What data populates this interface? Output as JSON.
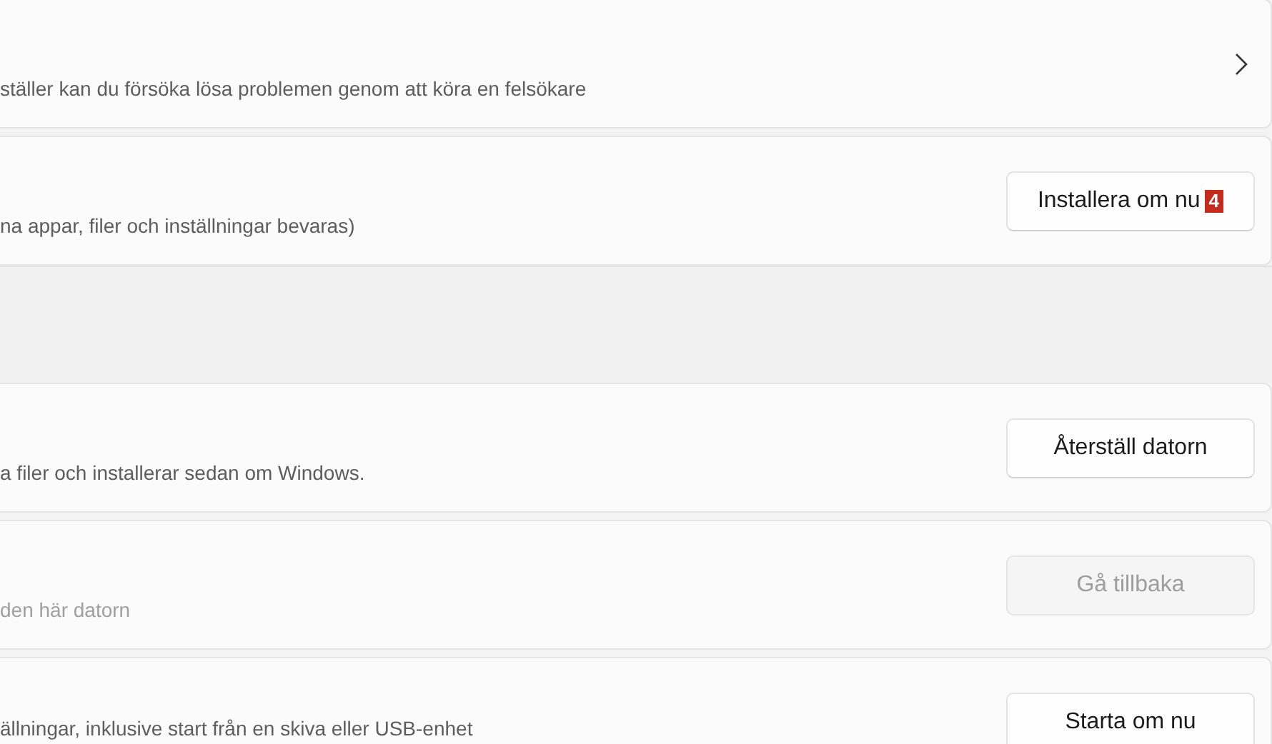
{
  "rows": [
    {
      "kind": "link",
      "description": "ställer kan du försöka lösa problemen genom att köra en felsökare",
      "disabled": false
    },
    {
      "kind": "button",
      "description": "na appar, filer och inställningar bevaras)",
      "button": "Installera om nu",
      "badge": "4",
      "disabled": false
    },
    {
      "kind": "blank"
    },
    {
      "kind": "button",
      "description": "a filer och installerar sedan om Windows.",
      "button": "Återställ datorn",
      "disabled": false
    },
    {
      "kind": "button",
      "description": "den här datorn",
      "button": "Gå tillbaka",
      "disabled": true
    },
    {
      "kind": "button",
      "description": "ällningar, inklusive start från en skiva eller USB-enhet",
      "button": "Starta om nu",
      "disabled": false
    }
  ]
}
